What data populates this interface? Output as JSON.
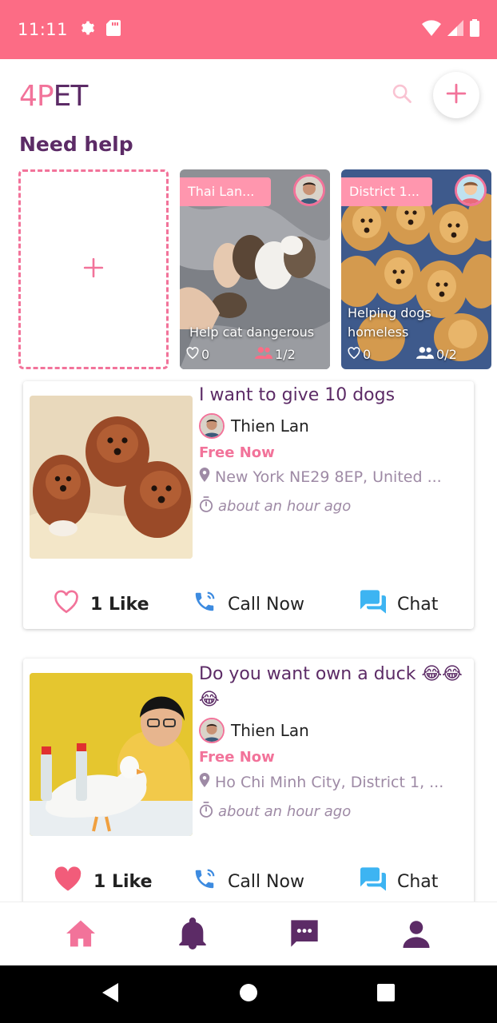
{
  "status_bar": {
    "time": "11:11",
    "icons": [
      "gear-icon",
      "sd-card-icon",
      "wifi-icon",
      "signal-icon",
      "battery-icon"
    ]
  },
  "app": {
    "logo_part1": "4P",
    "logo_part2": "ET",
    "colors": {
      "brand_pink": "#F2739A",
      "status_pink": "#FC6C85",
      "purple": "#5C2B66",
      "muted": "#9E8AA5",
      "chat_blue": "#3DB4F2"
    }
  },
  "need_help": {
    "title": "Need help",
    "add_icon": "plus-icon",
    "cards": [
      {
        "tag": "Thai Lan...",
        "title": "Help cat dangerous",
        "likes": "0",
        "members": "1/2"
      },
      {
        "tag": "District 1...",
        "title": "Helping dogs homeless",
        "likes": "0",
        "members": "0/2"
      }
    ]
  },
  "posts": [
    {
      "title": "I want to give 10 dogs",
      "user": "Thien Lan",
      "status": "Free Now",
      "location": "New York NE29 8EP, United ...",
      "time": "about an hour ago",
      "likes": "1 Like",
      "liked": false,
      "call_label": "Call Now",
      "chat_label": "Chat"
    },
    {
      "title": "Do you want own a duck 😂😂😂",
      "user": "Thien Lan",
      "status": "Free Now",
      "location": "Ho Chi Minh City, District 1, ...",
      "time": "about an hour ago",
      "likes": "1 Like",
      "liked": true,
      "call_label": "Call Now",
      "chat_label": "Chat"
    }
  ],
  "bottom_nav": [
    "home-icon",
    "bell-icon",
    "message-icon",
    "profile-icon"
  ],
  "system_nav": [
    "back-icon",
    "home-circle-icon",
    "recents-icon"
  ]
}
